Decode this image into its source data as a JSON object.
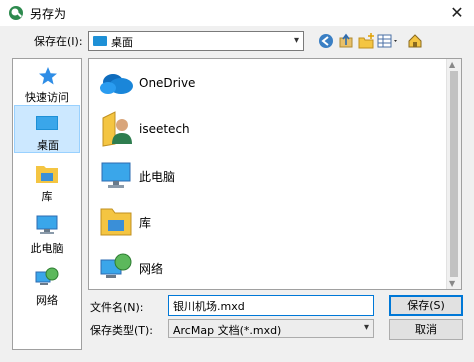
{
  "window": {
    "title": "另存为",
    "close_glyph": "✕"
  },
  "toolbar": {
    "save_in_label": "保存在(I):",
    "save_in_value": "桌面"
  },
  "places": [
    {
      "label": "快速访问",
      "icon": "star-icon"
    },
    {
      "label": "桌面",
      "icon": "desktop-icon",
      "selected": true
    },
    {
      "label": "库",
      "icon": "library-icon"
    },
    {
      "label": "此电脑",
      "icon": "computer-icon"
    },
    {
      "label": "网络",
      "icon": "network-icon"
    }
  ],
  "files": [
    {
      "label": "OneDrive",
      "icon": "cloud-icon"
    },
    {
      "label": "iseetech",
      "icon": "user-folder-icon"
    },
    {
      "label": "此电脑",
      "icon": "computer-icon"
    },
    {
      "label": "库",
      "icon": "library-icon"
    },
    {
      "label": "网络",
      "icon": "network-icon"
    }
  ],
  "form": {
    "filename_label": "文件名(N):",
    "filename_value": "银川机场.mxd",
    "filetype_label": "保存类型(T):",
    "filetype_value": "ArcMap 文档(*.mxd)",
    "save_label": "保存(S)",
    "cancel_label": "取消"
  },
  "colors": {
    "accent": "#0078d7",
    "folder_blue": "#1e90d6",
    "folder_yellow": "#f4c542"
  }
}
